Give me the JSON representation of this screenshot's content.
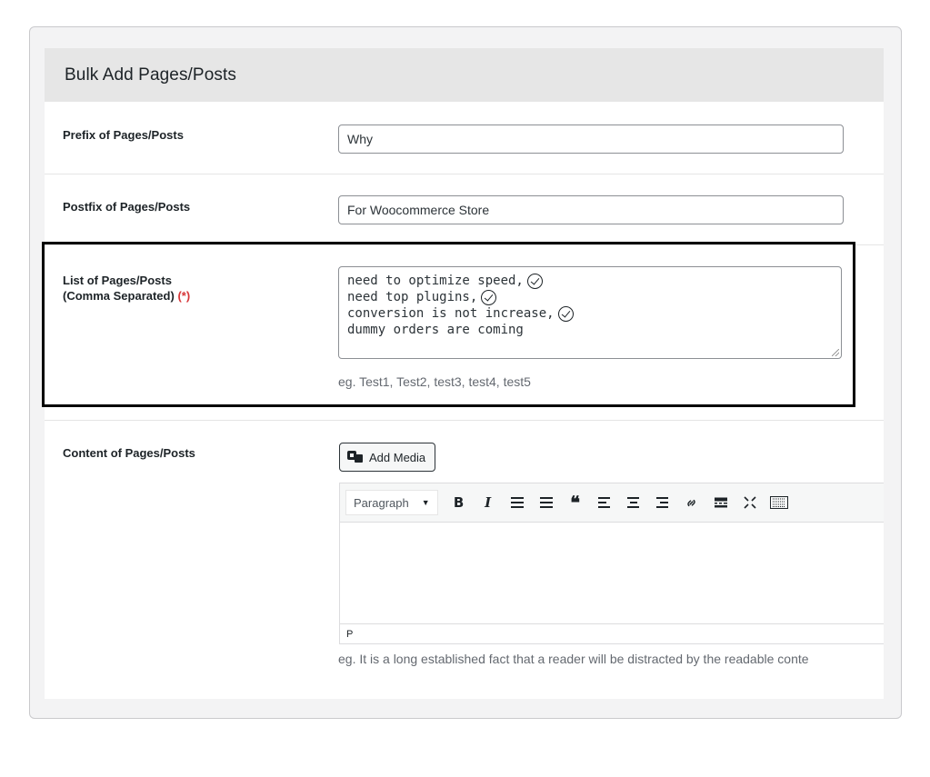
{
  "header": {
    "title": "Bulk Add Pages/Posts"
  },
  "fields": {
    "prefix": {
      "label": "Prefix of Pages/Posts",
      "value": "Why"
    },
    "postfix": {
      "label": "Postfix of Pages/Posts",
      "value": "For Woocommerce Store"
    },
    "list": {
      "label_line1": "List of Pages/Posts",
      "label_line2": "(Comma Separated)",
      "required_marker": "(*)",
      "lines": [
        "need to optimize speed,",
        "need top plugins,",
        "conversion is not increase,",
        "dummy orders are coming"
      ],
      "hint": "eg. Test1, Test2, test3, test4, test5"
    },
    "content": {
      "label": "Content of Pages/Posts",
      "add_media_label": "Add Media",
      "format_value": "Paragraph",
      "status_path": "P",
      "hint": "eg. It is a long established fact that a reader will be distracted by the readable conte"
    }
  },
  "toolbar_buttons": [
    {
      "name": "bold",
      "glyph": "B"
    },
    {
      "name": "italic",
      "glyph": "I"
    },
    {
      "name": "bulleted-list",
      "glyph": "☰"
    },
    {
      "name": "numbered-list",
      "glyph": "☰"
    },
    {
      "name": "blockquote",
      "glyph": "❝"
    },
    {
      "name": "align-left",
      "glyph": "≡"
    },
    {
      "name": "align-center",
      "glyph": "≡"
    },
    {
      "name": "align-right",
      "glyph": "≡"
    },
    {
      "name": "link",
      "glyph": "🔗"
    },
    {
      "name": "read-more",
      "glyph": "▬"
    },
    {
      "name": "fullscreen",
      "glyph": "✕"
    },
    {
      "name": "toolbar-toggle",
      "glyph": "▦"
    }
  ],
  "colors": {
    "required": "#d63638",
    "header_bg": "#e6e6e6",
    "highlight": "#000000"
  }
}
